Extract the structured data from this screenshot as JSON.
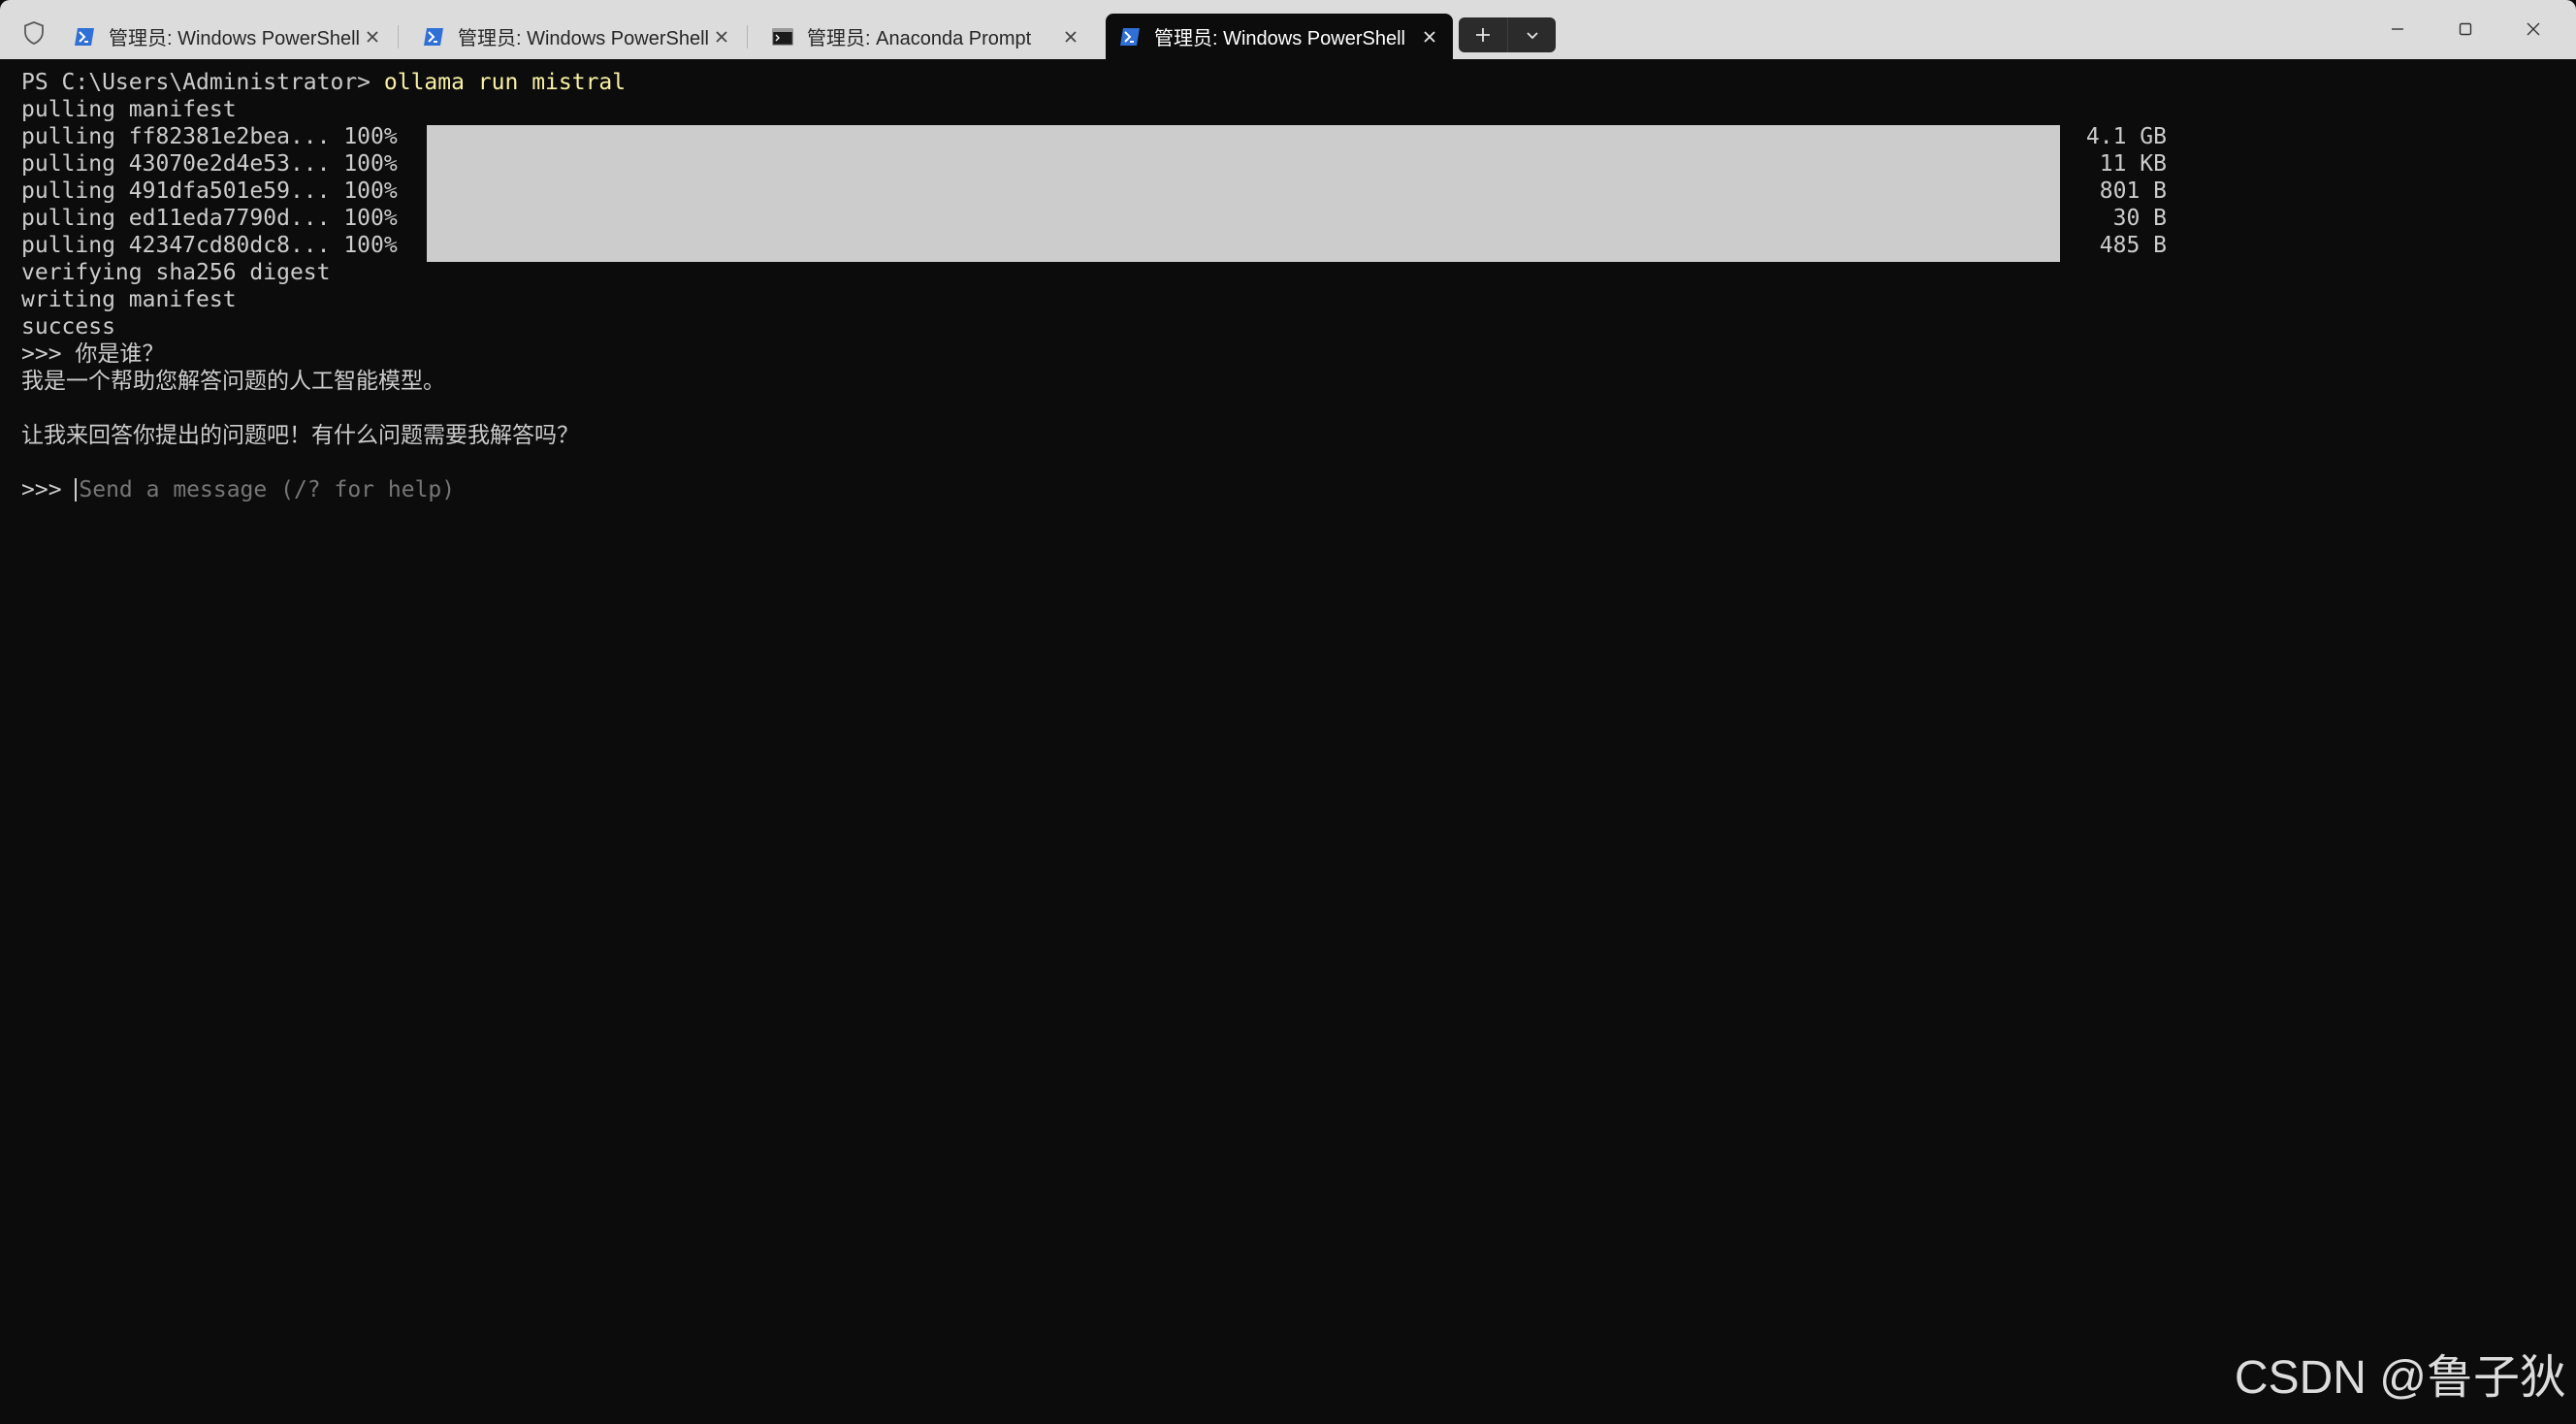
{
  "tabs": [
    {
      "title": "管理员: Windows PowerShell",
      "icon": "powershell-icon",
      "active": false
    },
    {
      "title": "管理员: Windows PowerShell",
      "icon": "powershell-icon",
      "active": false
    },
    {
      "title": "管理员: Anaconda Prompt",
      "icon": "cmd-icon",
      "active": false
    },
    {
      "title": "管理员: Windows PowerShell",
      "icon": "powershell-icon",
      "active": true
    }
  ],
  "colors": {
    "terminal_bg": "#0c0c0c",
    "terminal_fg": "#cccccc",
    "command": "#f9f1a5",
    "progress_fill": "#cccccc",
    "titlebar_bg": "#dcdcdc",
    "powershell_icon": "#2f6fd6"
  },
  "terminal": {
    "prompt": "PS C:\\Users\\Administrator> ",
    "command": "ollama run mistral",
    "manifest": "pulling manifest",
    "pulls": [
      {
        "text": "pulling ff82381e2bea... 100%",
        "size": "4.1 GB",
        "progress": 1.0
      },
      {
        "text": "pulling 43070e2d4e53... 100%",
        "size": "11 KB",
        "progress": 1.0
      },
      {
        "text": "pulling 491dfa501e59... 100%",
        "size": "801 B",
        "progress": 1.0
      },
      {
        "text": "pulling ed11eda7790d... 100%",
        "size": "30 B",
        "progress": 1.0
      },
      {
        "text": "pulling 42347cd80dc8... 100%",
        "size": "485 B",
        "progress": 1.0
      }
    ],
    "verify": "verifying sha256 digest",
    "writing": "writing manifest",
    "success": "success",
    "question": ">>> 你是谁？",
    "answer1": "我是一个帮助您解答问题的人工智能模型。",
    "answer2": "让我来回答你提出的问题吧！有什么问题需要我解答吗？",
    "input_prompt": ">>> ",
    "input_placeholder": "Send a message (/? for help)"
  },
  "watermark": "CSDN @鲁子狄"
}
